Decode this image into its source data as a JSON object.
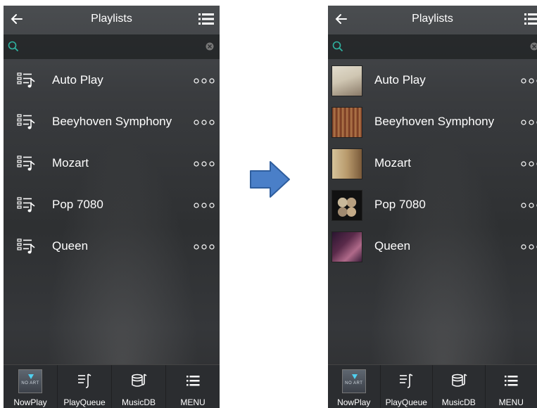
{
  "screens": [
    {
      "header": {
        "title": "Playlists"
      },
      "search": {
        "placeholder": ""
      },
      "playlists": [
        {
          "label": "Auto Play"
        },
        {
          "label": "Beeyhoven Symphony"
        },
        {
          "label": "Mozart"
        },
        {
          "label": "Pop 7080"
        },
        {
          "label": "Queen"
        }
      ],
      "bottom_nav": [
        {
          "label": "NowPlay",
          "icon": "no-art-thumbnail"
        },
        {
          "label": "PlayQueue",
          "icon": "play-queue-icon"
        },
        {
          "label": "MusicDB",
          "icon": "music-db-icon"
        },
        {
          "label": "MENU",
          "icon": "menu-icon"
        }
      ],
      "now_play_art_text": "NO ART"
    },
    {
      "header": {
        "title": "Playlists"
      },
      "search": {
        "placeholder": ""
      },
      "playlists": [
        {
          "label": "Auto Play",
          "thumb_colors": [
            "#d8d0c0",
            "#8a7a68"
          ]
        },
        {
          "label": "Beeyhoven Symphony",
          "thumb_colors": [
            "#7a3a22",
            "#c9a070"
          ]
        },
        {
          "label": "Mozart",
          "thumb_colors": [
            "#c9b48a",
            "#7a5a3a"
          ]
        },
        {
          "label": "Pop 7080",
          "thumb_colors": [
            "#111111",
            "#c8b89a"
          ]
        },
        {
          "label": "Queen",
          "thumb_colors": [
            "#3a1d3a",
            "#b06a8a"
          ]
        }
      ],
      "bottom_nav": [
        {
          "label": "NowPlay",
          "icon": "no-art-thumbnail"
        },
        {
          "label": "PlayQueue",
          "icon": "play-queue-icon"
        },
        {
          "label": "MusicDB",
          "icon": "music-db-icon"
        },
        {
          "label": "MENU",
          "icon": "menu-icon"
        }
      ],
      "now_play_art_text": "NO ART"
    }
  ],
  "colors": {
    "accent_search": "#2fb3a0",
    "arrow_fill": "#4a7fc8",
    "arrow_stroke": "#2f5e9e"
  }
}
